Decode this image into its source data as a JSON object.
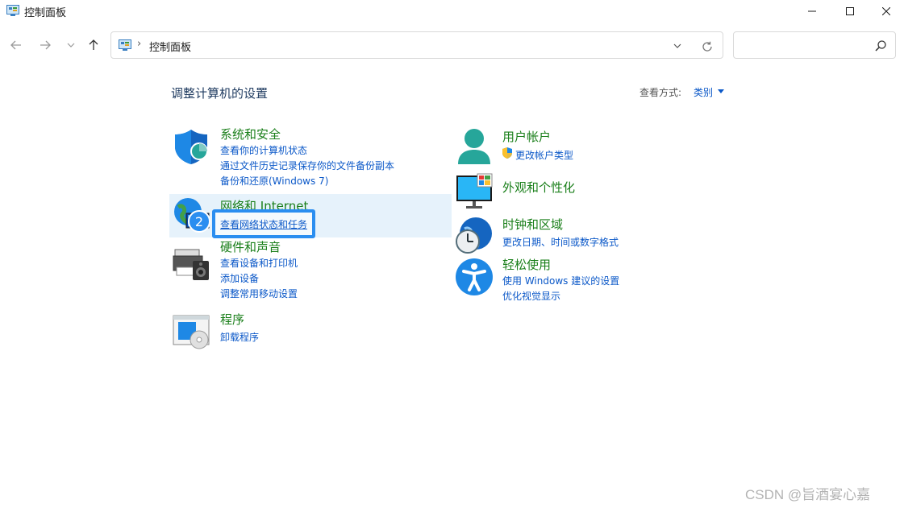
{
  "window": {
    "title": "控制面板"
  },
  "address": {
    "path": "控制面板",
    "separator": "›"
  },
  "search": {
    "placeholder": ""
  },
  "main": {
    "title": "调整计算机的设置",
    "view_by_label": "查看方式:",
    "view_by_value": "类别"
  },
  "categories": {
    "system": {
      "title": "系统和安全",
      "links": [
        "查看你的计算机状态",
        "通过文件历史记录保存你的文件备份副本",
        "备份和还原(Windows 7)"
      ]
    },
    "network": {
      "title": "网络和 Internet",
      "links": [
        "查看网络状态和任务"
      ]
    },
    "hardware": {
      "title": "硬件和声音",
      "links": [
        "查看设备和打印机",
        "添加设备",
        "调整常用移动设置"
      ]
    },
    "programs": {
      "title": "程序",
      "links": [
        "卸载程序"
      ]
    },
    "users": {
      "title": "用户帐户",
      "links": [
        "更改帐户类型"
      ]
    },
    "appearance": {
      "title": "外观和个性化",
      "links": []
    },
    "clock": {
      "title": "时钟和区域",
      "links": [
        "更改日期、时间或数字格式"
      ]
    },
    "ease": {
      "title": "轻松使用",
      "links": [
        "使用 Windows 建议的设置",
        "优化视觉显示"
      ]
    }
  },
  "annotation": {
    "step_number": "2"
  },
  "watermark": "CSDN @旨酒宴心嘉",
  "colors": {
    "link": "#0b58c8",
    "category_title": "#1a7f1a",
    "highlight": "#e6f2fb",
    "focus": "#2b8ef0"
  }
}
